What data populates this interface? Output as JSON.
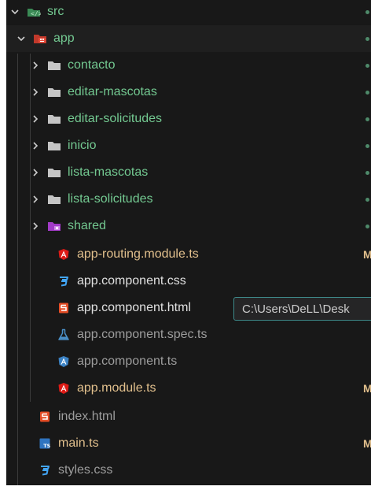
{
  "tree": {
    "src": {
      "label": "src",
      "expanded": true
    },
    "app": {
      "label": "app",
      "expanded": true
    },
    "folders": [
      {
        "label": "contacto"
      },
      {
        "label": "editar-mascotas"
      },
      {
        "label": "editar-solicitudes"
      },
      {
        "label": "inicio"
      },
      {
        "label": "lista-mascotas"
      },
      {
        "label": "lista-solicitudes"
      },
      {
        "label": "shared"
      }
    ],
    "app_files": [
      {
        "label": "app-routing.module.ts",
        "icon": "angular-icon",
        "status": "M"
      },
      {
        "label": "app.component.css",
        "icon": "css-icon",
        "status": ""
      },
      {
        "label": "app.component.html",
        "icon": "html-icon",
        "status": ""
      },
      {
        "label": "app.component.spec.ts",
        "icon": "flask-icon",
        "status": ""
      },
      {
        "label": "app.component.ts",
        "icon": "angular-icon",
        "status": ""
      },
      {
        "label": "app.module.ts",
        "icon": "angular-icon",
        "status": "M"
      }
    ],
    "src_files": [
      {
        "label": "index.html",
        "icon": "html-icon",
        "status": ""
      },
      {
        "label": "main.ts",
        "icon": "typescript-icon",
        "status": "M"
      },
      {
        "label": "styles.css",
        "icon": "css-icon",
        "status": ""
      }
    ]
  },
  "tooltip": {
    "text": "C:\\Users\\DeLL\\Desk"
  },
  "colors": {
    "background": "#181818",
    "untracked_green": "#73c991",
    "modified_orange": "#e2c08d",
    "tooltip_border": "#3e8a8a"
  }
}
